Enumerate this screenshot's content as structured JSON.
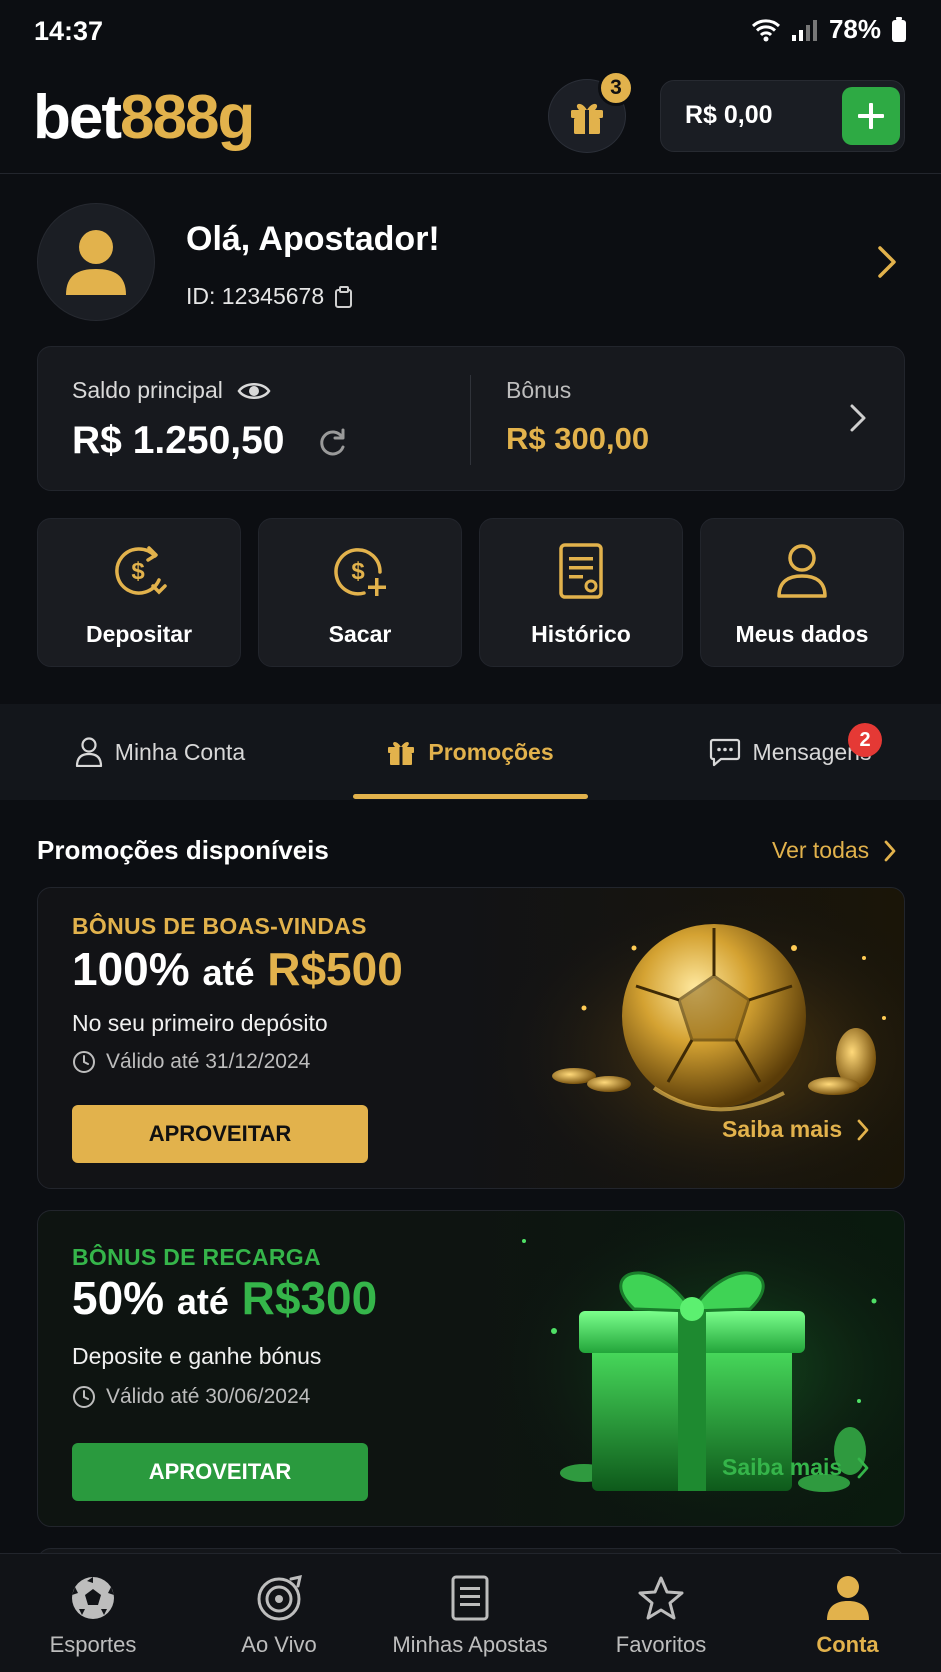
{
  "status_bar": {
    "time": "14:37",
    "battery": "78%"
  },
  "header": {
    "logo_part1": "bet",
    "logo_part2": "888g",
    "gift_count": "3",
    "balance": "R$ 0,00"
  },
  "profile": {
    "greeting": "Olá, Apostador!",
    "id": "ID: 12345678"
  },
  "balance_card": {
    "main_label": "Saldo principal",
    "main_value": "R$ 1.250,50",
    "bonus_label": "Bônus",
    "bonus_value": "R$ 300,00"
  },
  "actions": [
    {
      "label": "Depositar",
      "icon": "deposit-icon"
    },
    {
      "label": "Sacar",
      "icon": "withdraw-icon"
    },
    {
      "label": "Histórico",
      "icon": "history-icon"
    },
    {
      "label": "Meus dados",
      "icon": "user-icon"
    }
  ],
  "tabs": {
    "account": "Minha Conta",
    "promotions": "Promoções",
    "messages": "Mensagens",
    "messages_badge": "2",
    "active": "promotions"
  },
  "promotions": {
    "title": "Promoções disponíveis",
    "see_all": "Ver todas",
    "items": [
      {
        "kicker": "BÔNUS DE BOAS-VINDAS",
        "percent": "100%",
        "ate": "até",
        "amount": "R$500",
        "subtitle": "No seu primeiro depósito",
        "valid": "Válido até 31/12/2024",
        "cta": "APROVEITAR",
        "more": "Saiba mais",
        "accent": "#e2b24c"
      },
      {
        "kicker": "BÔNUS DE RECARGA",
        "percent": "50%",
        "ate": "até",
        "amount": "R$300",
        "subtitle": "Deposite e ganhe bónus",
        "valid": "Válido até 30/06/2024",
        "cta": "APROVEITAR",
        "more": "Saiba mais",
        "accent": "#35b54a"
      }
    ]
  },
  "bottom_nav": [
    {
      "label": "Esportes",
      "icon": "soccer-ball-icon"
    },
    {
      "label": "Ao Vivo",
      "icon": "live-target-icon"
    },
    {
      "label": "Minhas Apostas",
      "icon": "bet-slip-icon"
    },
    {
      "label": "Favoritos",
      "icon": "star-icon"
    },
    {
      "label": "Conta",
      "icon": "user-icon",
      "active": true
    }
  ],
  "colors": {
    "gold": "#e2b24c",
    "green": "#2eaa44",
    "background": "#0c0e12",
    "badge_red": "#e53935"
  }
}
